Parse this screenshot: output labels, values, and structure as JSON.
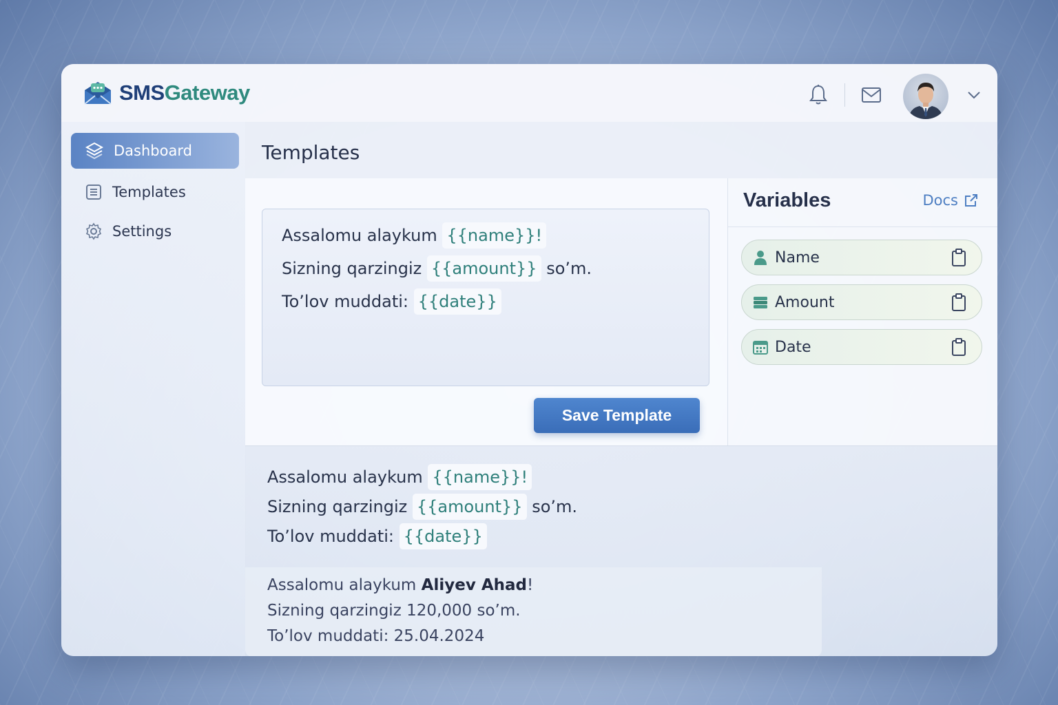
{
  "brand": {
    "part1": "SMS",
    "part2": "Gateway"
  },
  "header": {
    "notification_icon": "bell-icon",
    "mail_icon": "mail-icon",
    "profile_icon": "chevron-down-icon"
  },
  "sidebar": {
    "items": [
      {
        "label": "Dashboard",
        "icon": "layers-icon",
        "active": true
      },
      {
        "label": "Templates",
        "icon": "document-icon",
        "active": false
      },
      {
        "label": "Settings",
        "icon": "gear-icon",
        "active": false
      }
    ]
  },
  "page": {
    "title": "Templates"
  },
  "editor": {
    "line1": {
      "text": "Assalomu alaykum ",
      "tag": "{{name}}!"
    },
    "line2": {
      "text": "Sizning qarzingiz ",
      "tag": "{{amount}}",
      "suffix": " so’m."
    },
    "line3": {
      "text": "To’lov muddati: ",
      "tag": "{{date}}"
    },
    "save_label": "Save Template"
  },
  "variables": {
    "title": "Variables",
    "docs_label": "Docs",
    "items": [
      {
        "label": "Name",
        "icon": "user-icon"
      },
      {
        "label": "Amount",
        "icon": "money-stack-icon"
      },
      {
        "label": "Date",
        "icon": "calendar-icon"
      }
    ]
  },
  "preview": {
    "line1": {
      "text": "Assalomu alaykum ",
      "tag": "{{name}}!"
    },
    "line2": {
      "text": "Sizning qarzingiz ",
      "tag": "{{amount}}",
      "suffix": " so’m."
    },
    "line3": {
      "text": "To’lov muddati: ",
      "tag": "{{date}}"
    }
  },
  "rendered": {
    "line1_prefix": "Assalomu alaykum ",
    "line1_name": "Aliyev Ahad",
    "line1_suffix": "!",
    "line2": "Sizning qarzingiz 120,000 so’m.",
    "line3": "To’lov muddati: 25.04.2024"
  },
  "colors": {
    "accent": "#3a6db8",
    "brand_dark": "#1f3f78",
    "brand_teal": "#2f8a7e",
    "tag_text": "#2e7f7a"
  }
}
